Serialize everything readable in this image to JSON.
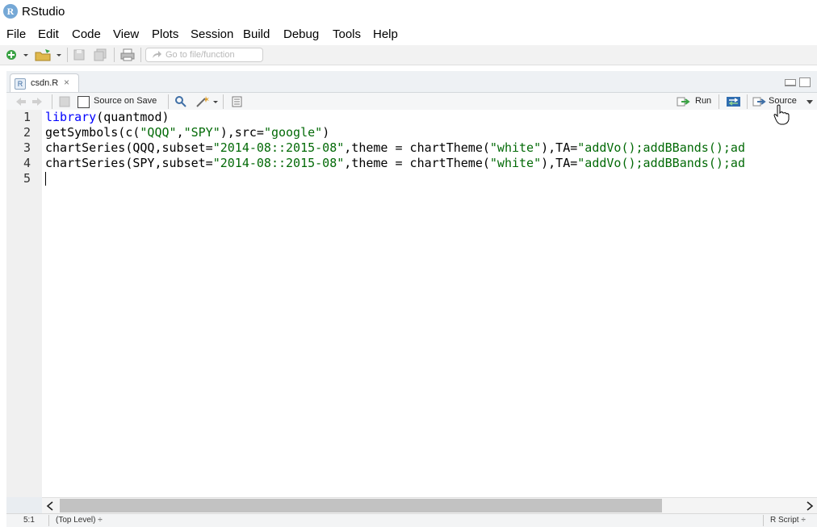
{
  "app": {
    "title": "RStudio",
    "logo_letter": "R"
  },
  "menu": [
    "File",
    "Edit",
    "Code",
    "View",
    "Plots",
    "Session",
    "Build",
    "Debug",
    "Tools",
    "Help"
  ],
  "toolbar": {
    "goto_placeholder": "Go to file/function"
  },
  "editor_tab": {
    "filename": "csdn.R",
    "close": "×"
  },
  "editor_toolbar": {
    "source_on_save": "Source on Save",
    "run_label": "Run",
    "source_label": "Source"
  },
  "code_lines": [
    [
      {
        "t": "library",
        "c": "kw"
      },
      {
        "t": "(quantmod)",
        "c": "plain"
      }
    ],
    [
      {
        "t": "getSymbols(c(",
        "c": "plain"
      },
      {
        "t": "\"QQQ\"",
        "c": "str"
      },
      {
        "t": ",",
        "c": "plain"
      },
      {
        "t": "\"SPY\"",
        "c": "str"
      },
      {
        "t": "),src=",
        "c": "plain"
      },
      {
        "t": "\"google\"",
        "c": "str"
      },
      {
        "t": ")",
        "c": "plain"
      }
    ],
    [
      {
        "t": "chartSeries(QQQ,subset=",
        "c": "plain"
      },
      {
        "t": "\"2014-08::2015-08\"",
        "c": "str"
      },
      {
        "t": ",theme = chartTheme(",
        "c": "plain"
      },
      {
        "t": "\"white\"",
        "c": "str"
      },
      {
        "t": "),TA=",
        "c": "plain"
      },
      {
        "t": "\"addVo();addBBands();ad",
        "c": "str"
      }
    ],
    [
      {
        "t": "chartSeries(SPY,subset=",
        "c": "plain"
      },
      {
        "t": "\"2014-08::2015-08\"",
        "c": "str"
      },
      {
        "t": ",theme = chartTheme(",
        "c": "plain"
      },
      {
        "t": "\"white\"",
        "c": "str"
      },
      {
        "t": "),TA=",
        "c": "plain"
      },
      {
        "t": "\"addVo();addBBands();ad",
        "c": "str"
      }
    ],
    []
  ],
  "line_numbers": [
    "1",
    "2",
    "3",
    "4",
    "5"
  ],
  "status": {
    "position": "5:1",
    "scope": "(Top Level) ÷",
    "filetype": "R Script ÷"
  },
  "colors": {
    "keyword": "#0000ff",
    "string": "#036a07",
    "accent": "#75a8d6"
  }
}
